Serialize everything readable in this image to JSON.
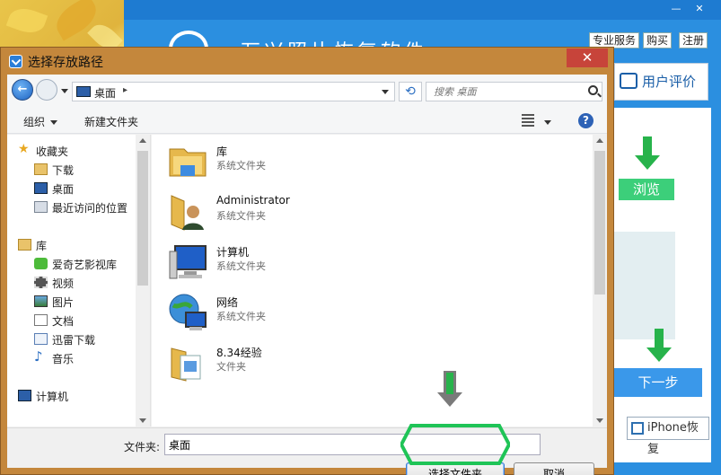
{
  "background_app": {
    "title": "万兴照片恢复软件",
    "top_buttons": [
      "专业服务",
      "购买",
      "注册"
    ],
    "review_label": "用户评价",
    "browse_label": "浏览",
    "next_label": "下一步",
    "restore_label": "iPhone恢复"
  },
  "dialog": {
    "title": "选择存放路径",
    "close_glyph": "✕",
    "address": {
      "location": "桌面",
      "separator": "▸"
    },
    "search": {
      "placeholder": "搜索 桌面"
    },
    "toolbar": {
      "organize_label": "组织",
      "new_folder_label": "新建文件夹",
      "help_glyph": "?"
    },
    "nav_pane": {
      "favorites_label": "收藏夹",
      "favorites": [
        "下载",
        "桌面",
        "最近访问的位置"
      ],
      "libraries_label": "库",
      "libraries": [
        "爱奇艺影视库",
        "视频",
        "图片",
        "文档",
        "迅雷下载",
        "音乐"
      ],
      "computer_label": "计算机"
    },
    "files": [
      {
        "name": "库",
        "type": "系统文件夹",
        "icon": "library-folder-icon"
      },
      {
        "name": "Administrator",
        "type": "系统文件夹",
        "icon": "user-folder-icon"
      },
      {
        "name": "计算机",
        "type": "系统文件夹",
        "icon": "computer-icon"
      },
      {
        "name": "网络",
        "type": "系统文件夹",
        "icon": "network-icon"
      },
      {
        "name": "8.34经验",
        "type": "文件夹",
        "icon": "folder-icon"
      }
    ],
    "folder_label": "文件夹:",
    "folder_value": "桌面",
    "select_button": "选择文件夹",
    "cancel_button": "取消"
  },
  "colors": {
    "accent_green": "#27b34b",
    "app_blue": "#2b8fe0",
    "dialog_frame": "#c4873c",
    "close_red": "#c7443a"
  }
}
